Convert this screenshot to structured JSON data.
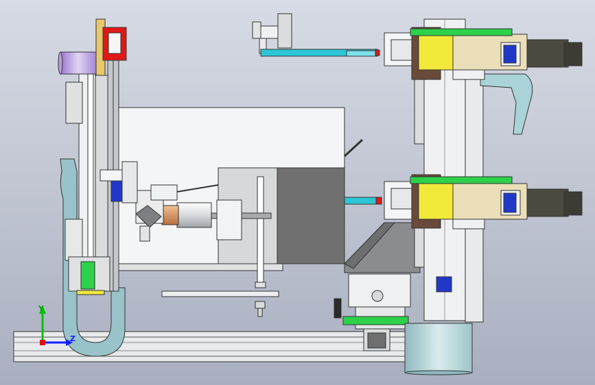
{
  "viewport": {
    "background_top": "#d7dbe5",
    "background_bottom": "#a9afbf"
  },
  "triad": {
    "y_label": "Y",
    "z_label": "Z",
    "y_color": "#00c000",
    "z_color": "#1020ff",
    "x_color": "#e01010"
  },
  "colors": {
    "metal": "#e6e8ea",
    "metal_dark": "#b8bcc0",
    "cyan": "#2cc6d6",
    "light_cyan": "#a9d3d6",
    "teal_part": "#98c3c8",
    "yellow": "#f2ea3a",
    "beige": "#eadfb8",
    "brown": "#6a4a3a",
    "motor": "#4a4a40",
    "green": "#2ed14a",
    "blue": "#2038c8",
    "lilac": "#c6a8e8",
    "red": "#e01818",
    "dark_gray": "#6f6f6f",
    "copper": "#d49560"
  }
}
